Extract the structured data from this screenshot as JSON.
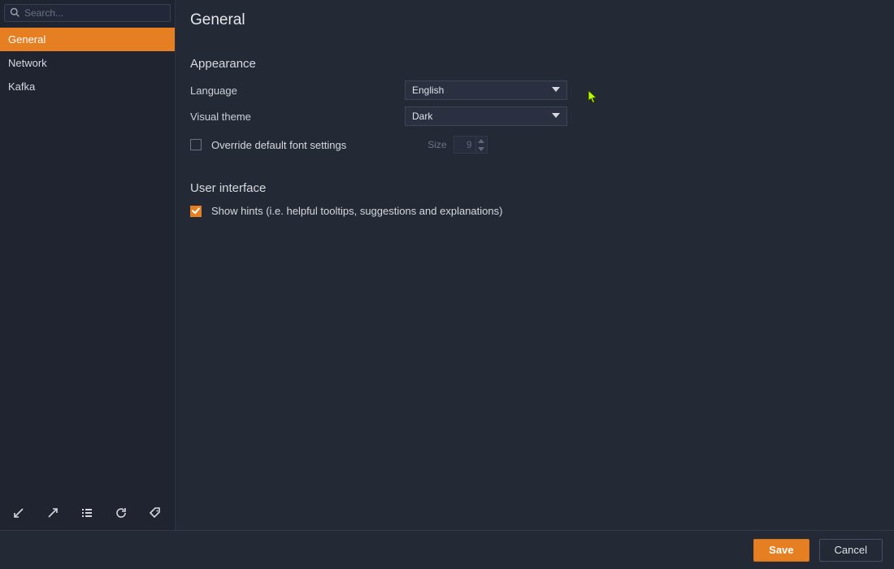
{
  "colors": {
    "accent": "#e67e22"
  },
  "sidebar": {
    "search_placeholder": "Search...",
    "items": [
      {
        "label": "General",
        "active": true
      },
      {
        "label": "Network",
        "active": false
      },
      {
        "label": "Kafka",
        "active": false
      }
    ]
  },
  "page": {
    "title": "General"
  },
  "appearance": {
    "title": "Appearance",
    "language_label": "Language",
    "language_value": "English",
    "theme_label": "Visual theme",
    "theme_value": "Dark",
    "override_fonts_label": "Override default font settings",
    "override_fonts_checked": false,
    "font_size_label": "Size",
    "font_size_value": "9"
  },
  "user_interface": {
    "title": "User interface",
    "show_hints_label": "Show hints (i.e. helpful tooltips, suggestions and explanations)",
    "show_hints_checked": true
  },
  "footer": {
    "save_label": "Save",
    "cancel_label": "Cancel"
  }
}
